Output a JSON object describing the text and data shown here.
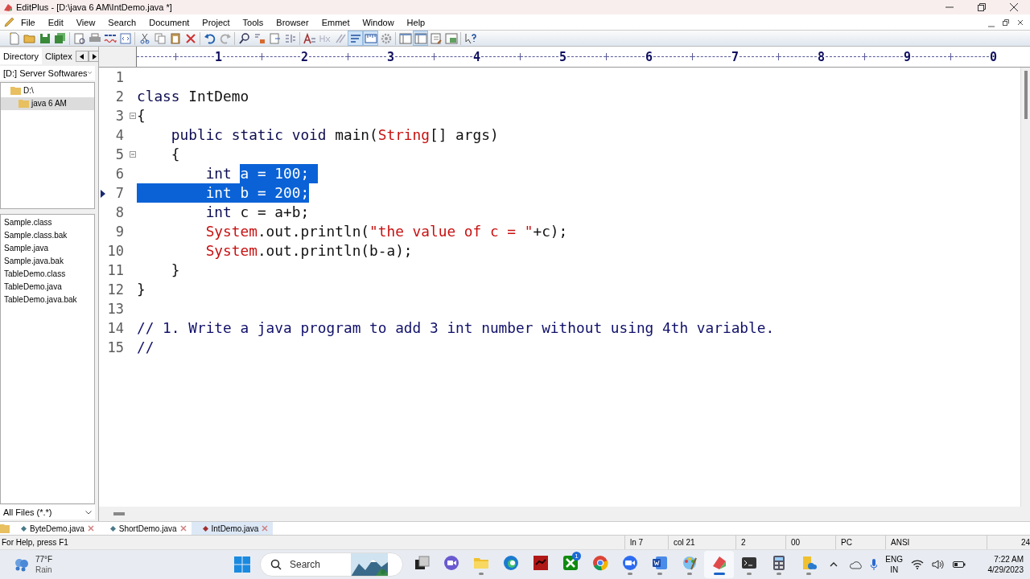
{
  "window": {
    "title": "EditPlus - [D:\\java 6 AM\\IntDemo.java *]"
  },
  "menu": [
    "File",
    "Edit",
    "View",
    "Search",
    "Document",
    "Project",
    "Tools",
    "Browser",
    "Emmet",
    "Window",
    "Help"
  ],
  "toolbar": [
    {
      "kind": "new",
      "pressed": false
    },
    {
      "kind": "open",
      "pressed": false
    },
    {
      "kind": "save",
      "pressed": false
    },
    {
      "kind": "saveall",
      "pressed": false
    },
    {
      "kind": "separator"
    },
    {
      "kind": "preview",
      "pressed": false
    },
    {
      "kind": "print",
      "pressed": false
    },
    {
      "kind": "spell",
      "pressed": false
    },
    {
      "kind": "browser",
      "pressed": false
    },
    {
      "kind": "separator"
    },
    {
      "kind": "cut",
      "pressed": false
    },
    {
      "kind": "copy",
      "pressed": false
    },
    {
      "kind": "paste",
      "pressed": false
    },
    {
      "kind": "delete",
      "pressed": false
    },
    {
      "kind": "separator"
    },
    {
      "kind": "undo",
      "pressed": false
    },
    {
      "kind": "redo",
      "pressed": false
    },
    {
      "kind": "separator"
    },
    {
      "kind": "find",
      "pressed": false
    },
    {
      "kind": "replace",
      "pressed": false
    },
    {
      "kind": "goto",
      "pressed": false
    },
    {
      "kind": "lines",
      "pressed": false
    },
    {
      "kind": "separator"
    },
    {
      "kind": "font",
      "pressed": false
    },
    {
      "kind": "hex",
      "pressed": false
    },
    {
      "kind": "bold",
      "pressed": false
    },
    {
      "kind": "wrap",
      "pressed": true
    },
    {
      "kind": "ruler",
      "pressed": true
    },
    {
      "kind": "gear",
      "pressed": false
    },
    {
      "kind": "separator"
    },
    {
      "kind": "panel",
      "pressed": false
    },
    {
      "kind": "panel",
      "pressed": true
    },
    {
      "kind": "cliptext",
      "pressed": false
    },
    {
      "kind": "output",
      "pressed": false
    },
    {
      "kind": "separator"
    },
    {
      "kind": "help",
      "pressed": false
    }
  ],
  "sidebar": {
    "tabs": [
      {
        "label": "Directory",
        "selected": true
      },
      {
        "label": "Cliptex",
        "selected": false
      }
    ],
    "drive": "[D:] Server Softwares",
    "tree": [
      {
        "label": "D:\\",
        "selected": false,
        "children": [
          {
            "label": "java 6 AM",
            "selected": true
          }
        ]
      }
    ],
    "files": [
      "Sample.class",
      "Sample.class.bak",
      "Sample.java",
      "Sample.java.bak",
      "TableDemo.class",
      "TableDemo.java",
      "TableDemo.java.bak"
    ],
    "filter": "All Files (*.*)"
  },
  "ruler": [
    "1",
    "2",
    "3",
    "4",
    "5",
    "6",
    "7",
    "8",
    "9",
    "0"
  ],
  "editor": {
    "lines": [
      {
        "number": "1",
        "fold": false,
        "current": false
      },
      {
        "number": "2",
        "fold": false,
        "current": false,
        "segments": [
          {
            "text": "class",
            "kind": "keyword",
            "selected": false
          },
          {
            "text": " IntDemo",
            "kind": "plain",
            "selected": false
          }
        ]
      },
      {
        "number": "3",
        "fold": true,
        "current": false,
        "segments": [
          {
            "text": "{",
            "kind": "plain",
            "selected": false
          }
        ]
      },
      {
        "number": "4",
        "fold": false,
        "current": false,
        "segments": [
          {
            "text": "    public static void",
            "kind": "keyword",
            "selected": false
          },
          {
            "text": " main(",
            "kind": "plain",
            "selected": false
          },
          {
            "text": "String",
            "kind": "type",
            "selected": false
          },
          {
            "text": "[] args)",
            "kind": "plain",
            "selected": false
          }
        ]
      },
      {
        "number": "5",
        "fold": true,
        "current": false,
        "segments": [
          {
            "text": "    {",
            "kind": "plain",
            "selected": false
          }
        ]
      },
      {
        "number": "6",
        "fold": false,
        "current": false,
        "segments": [
          {
            "text": "        int ",
            "kind": "keyword",
            "selected": false
          },
          {
            "text": "a = 100; ",
            "kind": "plain",
            "selected": true
          }
        ]
      },
      {
        "number": "7",
        "fold": false,
        "current": true,
        "segments": [
          {
            "text": "        int",
            "kind": "keyword",
            "selected": true
          },
          {
            "text": " b = 200;",
            "kind": "plain",
            "selected": true
          }
        ]
      },
      {
        "number": "8",
        "fold": false,
        "current": false,
        "segments": [
          {
            "text": "        int",
            "kind": "keyword",
            "selected": false
          },
          {
            "text": " c = a+b;",
            "kind": "plain",
            "selected": false
          }
        ]
      },
      {
        "number": "9",
        "fold": false,
        "current": false,
        "segments": [
          {
            "text": "        System",
            "kind": "type",
            "selected": false
          },
          {
            "text": ".out.println(",
            "kind": "plain",
            "selected": false
          },
          {
            "text": "\"the value of c = \"",
            "kind": "string",
            "selected": false
          },
          {
            "text": "+c);",
            "kind": "plain",
            "selected": false
          }
        ]
      },
      {
        "number": "10",
        "fold": false,
        "current": false,
        "segments": [
          {
            "text": "        System",
            "kind": "type",
            "selected": false
          },
          {
            "text": ".out.println(b-a);",
            "kind": "plain",
            "selected": false
          }
        ]
      },
      {
        "number": "11",
        "fold": false,
        "current": false,
        "segments": [
          {
            "text": "    }",
            "kind": "plain",
            "selected": false
          }
        ]
      },
      {
        "number": "12",
        "fold": false,
        "current": false,
        "segments": [
          {
            "text": "}",
            "kind": "plain",
            "selected": false
          }
        ]
      },
      {
        "number": "13",
        "fold": false,
        "current": false
      },
      {
        "number": "14",
        "fold": false,
        "current": false,
        "segments": [
          {
            "text": "// 1. Write a java program to add 3 int number without using 4th variable.",
            "kind": "comment",
            "selected": false
          }
        ]
      },
      {
        "number": "15",
        "fold": false,
        "current": false,
        "segments": [
          {
            "text": "//",
            "kind": "comment",
            "selected": false
          }
        ]
      }
    ]
  },
  "document_tabs": [
    {
      "label": "ByteDemo.java",
      "selected": false
    },
    {
      "label": "ShortDemo.java",
      "selected": false
    },
    {
      "label": "IntDemo.java",
      "selected": true
    }
  ],
  "status_bar": {
    "help": "For Help, press F1",
    "line": "ln 7",
    "column": "col 21",
    "field_3": "2",
    "field_4": "00",
    "line_ending": "PC",
    "encoding": "ANSI",
    "field_7": "24"
  },
  "taskbar": {
    "weather": {
      "temperature": "77°F",
      "condition": "Rain"
    },
    "search": {
      "placeholder": "Search"
    },
    "apps": [
      {
        "kind": "taskview",
        "running": false,
        "active": false
      },
      {
        "kind": "meet",
        "running": false,
        "active": false
      },
      {
        "kind": "files",
        "running": true,
        "active": false
      },
      {
        "kind": "edge",
        "running": false,
        "active": false
      },
      {
        "kind": "game",
        "running": false,
        "active": false
      },
      {
        "kind": "xbox",
        "running": false,
        "active": false,
        "badge": "1"
      },
      {
        "kind": "chrome",
        "running": false,
        "active": false
      },
      {
        "kind": "zoom",
        "running": true,
        "active": false
      },
      {
        "kind": "word",
        "running": true,
        "active": false
      },
      {
        "kind": "paint",
        "running": true,
        "active": false
      },
      {
        "kind": "editplus",
        "running": true,
        "active": true
      },
      {
        "kind": "terminal",
        "running": true,
        "active": false
      },
      {
        "kind": "calculator",
        "running": true,
        "active": false
      },
      {
        "kind": "onedrive",
        "running": true,
        "active": false
      }
    ],
    "language": [
      "ENG",
      "IN"
    ],
    "time": "7:22 AM",
    "date": "4/29/2023"
  }
}
